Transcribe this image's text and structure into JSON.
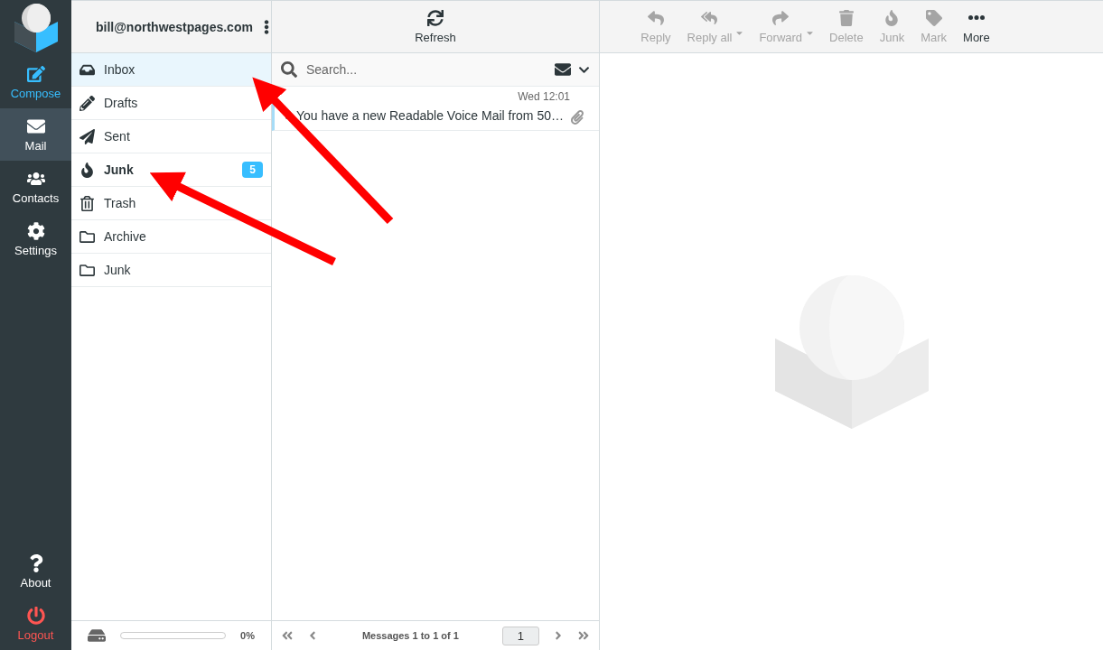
{
  "account": "bill@northwestpages.com",
  "nav": [
    {
      "kind": "compose",
      "label": "Compose",
      "selected": false
    },
    {
      "kind": "mail",
      "label": "Mail",
      "selected": true
    },
    {
      "kind": "contacts",
      "label": "Contacts",
      "selected": false
    },
    {
      "kind": "settings",
      "label": "Settings",
      "selected": false
    }
  ],
  "nav_bottom": [
    {
      "kind": "about",
      "label": "About"
    },
    {
      "kind": "logout",
      "label": "Logout"
    }
  ],
  "folders": [
    {
      "kind": "inbox",
      "label": "Inbox",
      "selected": true,
      "unread": false
    },
    {
      "kind": "drafts",
      "label": "Drafts",
      "selected": false,
      "unread": false
    },
    {
      "kind": "sent",
      "label": "Sent",
      "selected": false,
      "unread": false
    },
    {
      "kind": "junk",
      "label": "Junk",
      "selected": false,
      "unread": true,
      "count": "5"
    },
    {
      "kind": "trash",
      "label": "Trash",
      "selected": false,
      "unread": false
    },
    {
      "kind": "folder",
      "label": "Archive",
      "selected": false,
      "unread": false
    },
    {
      "kind": "folder",
      "label": "Junk",
      "selected": false,
      "unread": false
    }
  ],
  "quota": {
    "level": 0,
    "reading": "0%"
  },
  "list_toolbar": {
    "refresh": "Refresh"
  },
  "search": {
    "placeholder": "Search..."
  },
  "messages": [
    {
      "date": "Wed 12:01",
      "subject": "You have a new Readable Voice Mail from 50…",
      "selected": true,
      "attachment": true
    }
  ],
  "pager": {
    "text": "Messages 1 to 1 of 1",
    "page": "1"
  },
  "toolbar": [
    {
      "kind": "reply",
      "label": "Reply",
      "disabled": true,
      "dropdown": false
    },
    {
      "kind": "replyall",
      "label": "Reply all",
      "disabled": true,
      "dropdown": true
    },
    {
      "kind": "forward",
      "label": "Forward",
      "disabled": true,
      "dropdown": true
    },
    {
      "kind": "delete",
      "label": "Delete",
      "disabled": true,
      "dropdown": false
    },
    {
      "kind": "junk",
      "label": "Junk",
      "disabled": true,
      "dropdown": false
    },
    {
      "kind": "mark",
      "label": "Mark",
      "disabled": true,
      "dropdown": false
    },
    {
      "kind": "more",
      "label": "More",
      "disabled": false,
      "dropdown": false
    }
  ]
}
